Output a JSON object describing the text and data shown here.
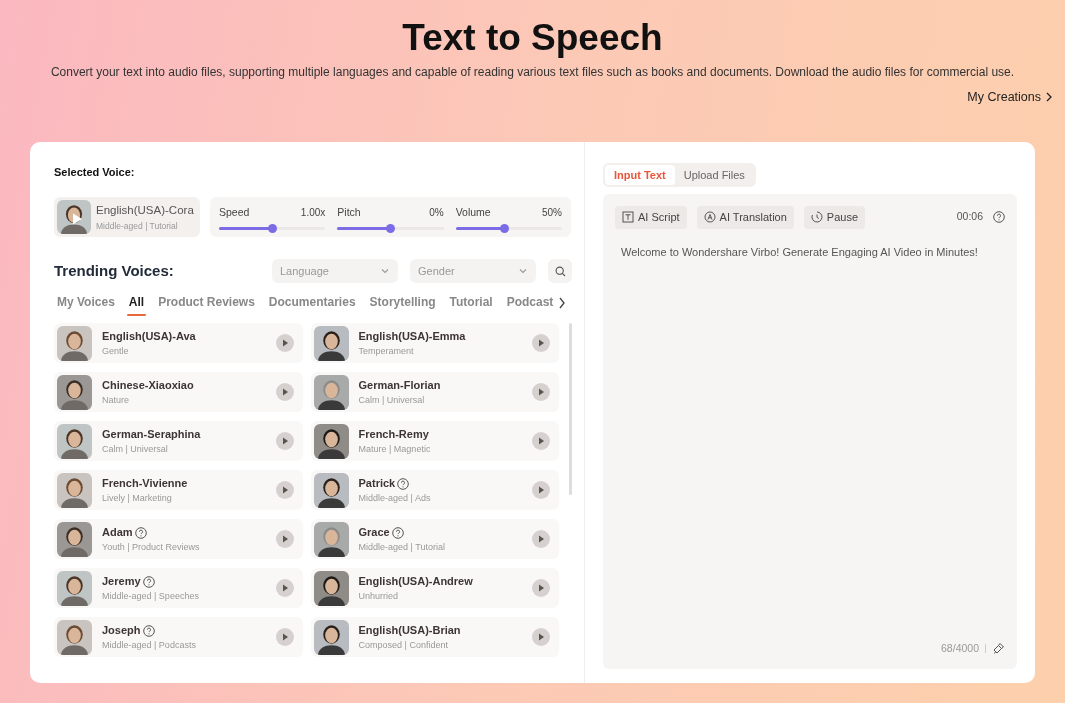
{
  "header": {
    "title": "Text to Speech",
    "subtitle": "Convert your text into audio files, supporting multiple languages and capable of reading various text files such as books and documents. Download the audio files for commercial use.",
    "link": "My Creations"
  },
  "selected_voice": {
    "label": "Selected Voice:",
    "name": "English(USA)-Cora",
    "tags": "Middle-aged | Tutorial"
  },
  "sliders": [
    {
      "label": "Speed",
      "reading": "1.00x",
      "level": 0.5
    },
    {
      "label": "Pitch",
      "reading": "0%",
      "level": 0.5
    },
    {
      "label": "Volume",
      "reading": "50%",
      "level": 0.45
    }
  ],
  "trending": {
    "title": "Trending Voices:",
    "filters": [
      {
        "placeholder": "Language"
      },
      {
        "placeholder": "Gender"
      }
    ]
  },
  "categories": [
    {
      "label": "My Voices",
      "selected": false
    },
    {
      "label": "All",
      "selected": true
    },
    {
      "label": "Product Reviews",
      "selected": false
    },
    {
      "label": "Documentaries",
      "selected": false
    },
    {
      "label": "Storytelling",
      "selected": false
    },
    {
      "label": "Tutorial",
      "selected": false
    },
    {
      "label": "Podcast",
      "selected": false
    }
  ],
  "voices": [
    {
      "name": "English(USA)-Ava",
      "tags": "Gentle",
      "help": false
    },
    {
      "name": "English(USA)-Emma",
      "tags": "Temperament",
      "help": false
    },
    {
      "name": "Chinese-Xiaoxiao",
      "tags": "Nature",
      "help": false
    },
    {
      "name": "German-Florian",
      "tags": "Calm | Universal",
      "help": false
    },
    {
      "name": "German-Seraphina",
      "tags": "Calm | Universal",
      "help": false
    },
    {
      "name": "French-Remy",
      "tags": "Mature | Magnetic",
      "help": false
    },
    {
      "name": "French-Vivienne",
      "tags": "Lively | Marketing",
      "help": false
    },
    {
      "name": "Patrick",
      "tags": "Middle-aged | Ads",
      "help": true
    },
    {
      "name": "Adam",
      "tags": "Youth | Product Reviews",
      "help": true
    },
    {
      "name": "Grace",
      "tags": "Middle-aged | Tutorial",
      "help": true
    },
    {
      "name": "Jeremy",
      "tags": "Middle-aged | Speeches",
      "help": true
    },
    {
      "name": "English(USA)-Andrew",
      "tags": "Unhurried",
      "help": false
    },
    {
      "name": "Joseph",
      "tags": "Middle-aged | Podcasts",
      "help": true
    },
    {
      "name": "English(USA)-Brian",
      "tags": "Composed | Confident",
      "help": false
    }
  ],
  "input_tabs": [
    {
      "label": "Input Text",
      "selected": true
    },
    {
      "label": "Upload Files",
      "selected": false
    }
  ],
  "tools": [
    {
      "label": "AI Script",
      "kind": "script"
    },
    {
      "label": "AI Translation",
      "kind": "translate"
    },
    {
      "label": "Pause",
      "kind": "pause"
    }
  ],
  "duration": "00:06",
  "text": "Welcome to Wondershare Virbo! Generate Engaging AI Video in Minutes!",
  "counter": "68/4000"
}
